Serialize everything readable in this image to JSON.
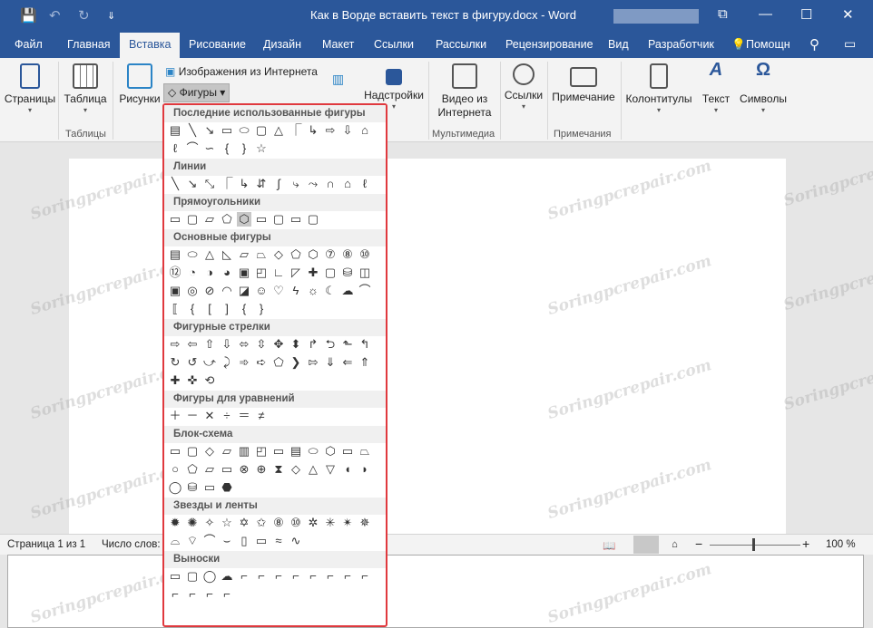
{
  "titlebar": {
    "title": "Как в Ворде вставить текст в фигуру.docx  -  Word",
    "save_icon": "💾",
    "undo_icon": "↶",
    "redo_icon": "↻",
    "customize_icon": "⇓",
    "restore_icon": "⧉",
    "minimize_icon": "—",
    "maximize_icon": "☐",
    "close_icon": "✕"
  },
  "tabs": [
    "Файл",
    "Главная",
    "Вставка",
    "Рисование",
    "Дизайн",
    "Макет",
    "Ссылки",
    "Рассылки",
    "Рецензирование",
    "Вид",
    "Разработчик"
  ],
  "help": "Помощн",
  "ribbon": {
    "pages": "Страницы",
    "table": "Таблица",
    "tables_group": "Таблицы",
    "pictures": "Рисунки",
    "online_images": "Изображения из Интернета",
    "shapes": "Фигуры",
    "addins": "Надстройки",
    "video_1": "Видео из",
    "video_2": "Интернета",
    "media_group": "Мультимедиа",
    "links": "Ссылки",
    "comment": "Примечание",
    "comments_group": "Примечания",
    "headers": "Колонтитулы",
    "text": "Текст",
    "symbols": "Символы"
  },
  "status": {
    "page": "Страница 1 из 1",
    "words": "Число слов:",
    "zoom": "100 %",
    "minus": "−",
    "plus": "+"
  },
  "dropdown": {
    "recent": "Последние использованные фигуры",
    "lines": "Линии",
    "rects": "Прямоугольники",
    "basic": "Основные фигуры",
    "arrows": "Фигурные стрелки",
    "equation": "Фигуры для уравнений",
    "flowchart": "Блок-схема",
    "stars": "Звезды и ленты",
    "callouts": "Выноски"
  },
  "watermark": "Soringpcrepair.com",
  "colors": {
    "accent": "#2b579a",
    "highlight": "#e0393e"
  }
}
